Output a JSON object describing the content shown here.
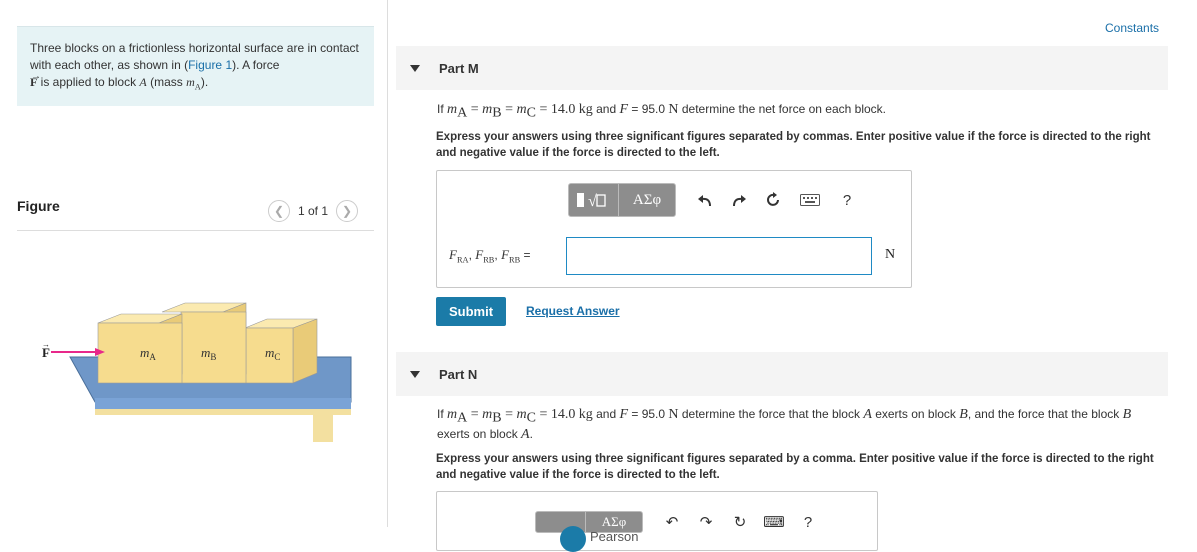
{
  "problem": {
    "text_1": "Three blocks on a frictionless horizontal surface are in contact with each other, as shown in (",
    "figure_link": "Figure 1",
    "text_2": "). A force",
    "force_symbol": "F",
    "text_3": " is applied to block ",
    "block_symbol": "A",
    "text_4": " (mass ",
    "mass_symbol": "m",
    "mass_sub": "A",
    "text_5": ")."
  },
  "figure": {
    "title": "Figure",
    "pager_text": "1 of 1",
    "prev_icon": "chevron-left-icon",
    "next_icon": "chevron-right-icon",
    "force_label": "F",
    "mass_labels": [
      "m",
      "m",
      "m"
    ],
    "mass_subs": [
      "A",
      "B",
      "C"
    ]
  },
  "header": {
    "constants_link": "Constants"
  },
  "part_m": {
    "title": "Part M",
    "q_if": "If ",
    "q_mA": "m",
    "q_mA_sub": "A",
    "q_eq1": " = ",
    "q_mB": "m",
    "q_mB_sub": "B",
    "q_eq2": " = ",
    "q_mC": "m",
    "q_mC_sub": "C",
    "q_eq3": " = ",
    "q_mass_val": "14.0",
    "q_mass_unit": "kg",
    "q_and": " and ",
    "q_F": "F",
    "q_eqF": " = 95.0 ",
    "q_F_unit": "N",
    "q_rest": " determine the net force on each block.",
    "instructions": "Express your answers using three significant figures separated by commas. Enter positive value if the force is directed to the right and negative value if the force is directed to the left.",
    "answer_label": {
      "f1": "F",
      "f1_sub": "RA",
      "sep1": ", ",
      "f2": "F",
      "f2_sub": "RB",
      "sep2": ", ",
      "f3": "F",
      "f3_sub": "RB",
      "eq": " ="
    },
    "answer_value": "",
    "unit": "N",
    "submit_label": "Submit",
    "request_label": "Request Answer"
  },
  "toolbar": {
    "template_icon": "math-template-icon",
    "greek_label": "ΑΣφ",
    "undo_icon": "undo-icon",
    "redo_icon": "redo-icon",
    "reset_icon": "reset-icon",
    "keyboard_icon": "keyboard-icon",
    "help_label": "?"
  },
  "part_n": {
    "title": "Part N",
    "q_if": "If ",
    "q_mA": "m",
    "q_mA_sub": "A",
    "q_eq1": " = ",
    "q_mB": "m",
    "q_mB_sub": "B",
    "q_eq2": " = ",
    "q_mC": "m",
    "q_mC_sub": "C",
    "q_eq3": " = ",
    "q_mass_val": "14.0",
    "q_mass_unit": "kg",
    "q_and": " and ",
    "q_F": "F",
    "q_eqF": " = 95.0 ",
    "q_F_unit": "N",
    "q_mid": " determine the force that the block ",
    "q_blockA": "A",
    "q_mid2": " exerts on block ",
    "q_blockB": "B",
    "q_mid3": ", and the force that the block ",
    "q_blockB2": "B",
    "q_mid4": " exerts on block ",
    "q_blockA2": "A",
    "q_end": ".",
    "instructions": "Express your answers using three significant figures separated by a comma. Enter positive value if the force is directed to the right and negative value if the force is directed to the left.",
    "greek_label": "ΑΣφ"
  },
  "footer": {
    "brand": "Pearson"
  },
  "colors": {
    "accent": "#1b7ba8",
    "force_arrow": "#e8288a",
    "block": "#f6dc8e",
    "table": "#6f97c8"
  }
}
